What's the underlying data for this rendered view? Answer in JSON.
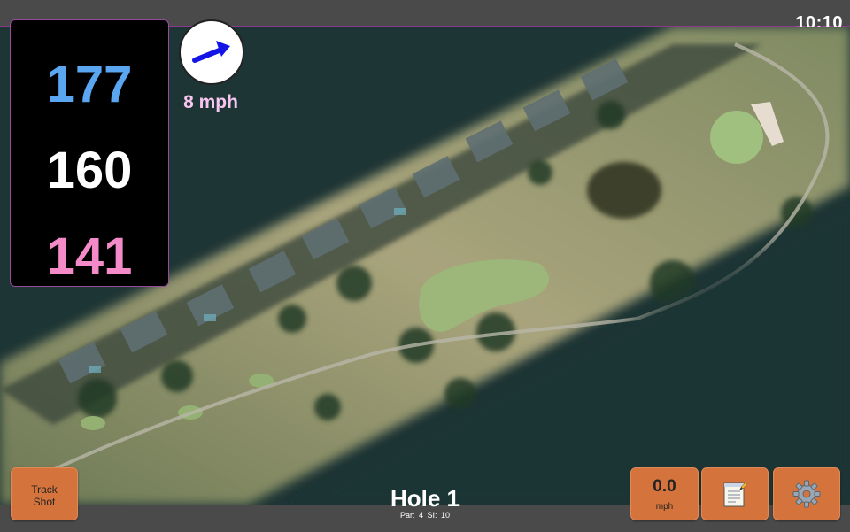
{
  "status_bar": {
    "clock": "10:10"
  },
  "yardages": {
    "back": "177",
    "middle": "160",
    "front": "141"
  },
  "wind": {
    "speed_label": "8 mph",
    "icon": "wind-arrow-icon",
    "direction": "east-northeast"
  },
  "hole": {
    "title": "Hole 1",
    "subtitle": "Par: 4   SI: 10"
  },
  "buttons": {
    "track_shot": "Track Shot",
    "speed_value": "0.0",
    "speed_unit": "mph",
    "notes_icon": "notepad-icon",
    "settings_icon": "gear-icon"
  },
  "colors": {
    "back_yardage": "#5aa6f0",
    "middle_yardage": "#ffffff",
    "front_yardage": "#f48ac8",
    "wind_text": "#f7c6f0",
    "button_bg": "#d4743c",
    "wind_arrow": "#1414e6"
  }
}
